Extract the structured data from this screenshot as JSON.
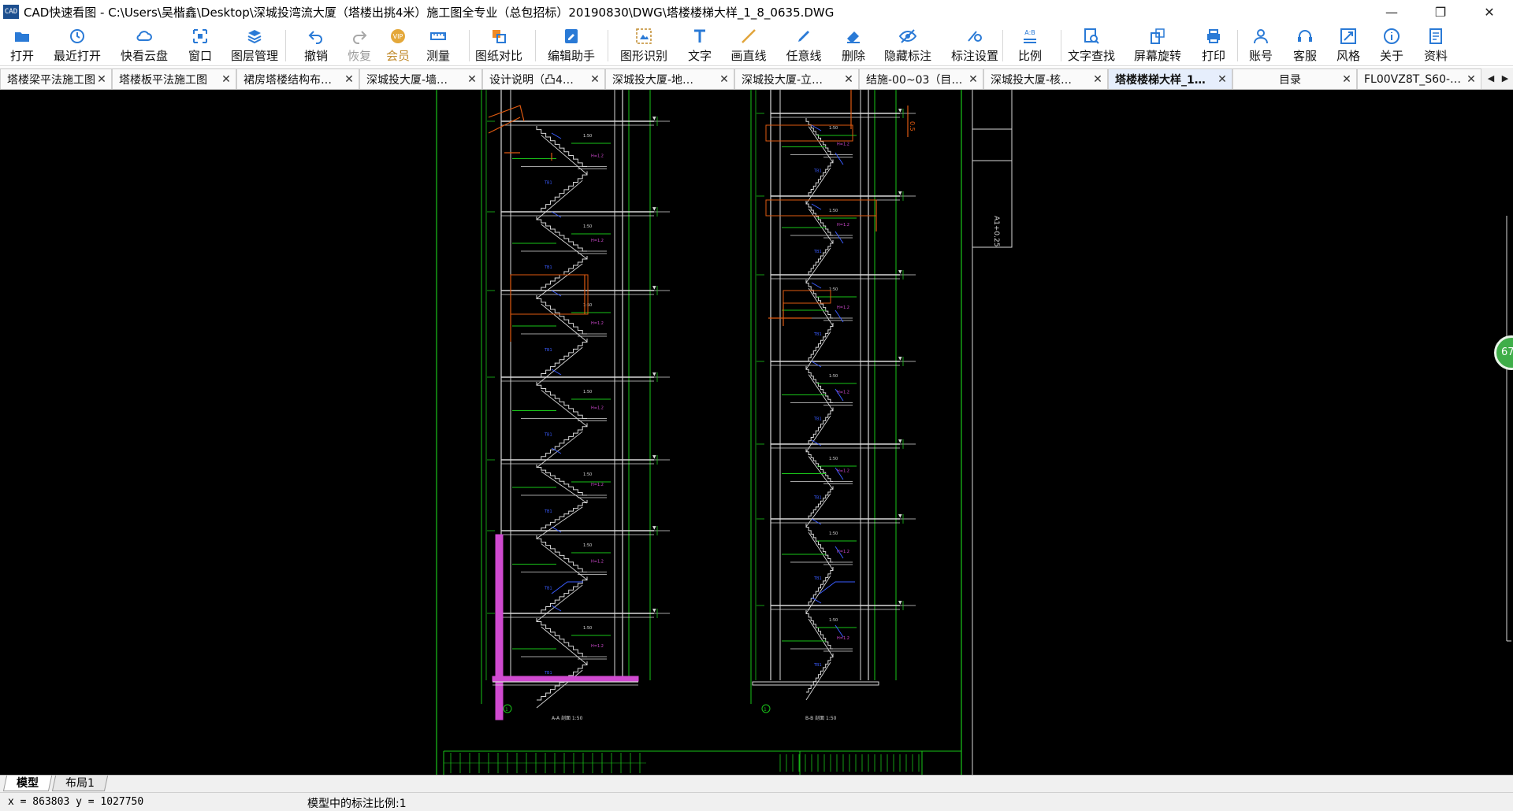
{
  "window": {
    "title": "CAD快速看图 - C:\\Users\\吴楷鑫\\Desktop\\深城投湾流大厦（塔楼出挑4米）施工图全专业（总包招标）20190830\\DWG\\塔楼楼梯大样_1_8_0635.DWG",
    "app_icon_text": "CAD",
    "minimize": "—",
    "maximize": "❐",
    "close": "✕"
  },
  "toolbar": [
    {
      "id": "open",
      "label": "打开",
      "icon": "folder-icon"
    },
    {
      "id": "recent",
      "label": "最近打开",
      "icon": "clock-icon"
    },
    {
      "id": "cloud",
      "label": "快看云盘",
      "icon": "cloud-icon"
    },
    {
      "id": "window",
      "label": "窗口",
      "icon": "window-icon"
    },
    {
      "id": "layers",
      "label": "图层管理",
      "icon": "layers-icon"
    },
    {
      "id": "undo",
      "label": "撤销",
      "icon": "undo-icon"
    },
    {
      "id": "redo",
      "label": "恢复",
      "icon": "redo-icon",
      "disabled": true
    },
    {
      "id": "vip",
      "label": "会员",
      "icon": "vip-icon",
      "badge": "VIP"
    },
    {
      "id": "measure",
      "label": "测量",
      "icon": "ruler-icon"
    },
    {
      "id": "compare",
      "label": "图纸对比",
      "icon": "compare-icon"
    },
    {
      "id": "edit",
      "label": "编辑助手",
      "icon": "edit-assistant-icon"
    },
    {
      "id": "recognize",
      "label": "图形识别",
      "icon": "shape-recognize-icon"
    },
    {
      "id": "text",
      "label": "文字",
      "icon": "text-icon"
    },
    {
      "id": "line",
      "label": "画直线",
      "icon": "line-icon"
    },
    {
      "id": "freeline",
      "label": "任意线",
      "icon": "pen-icon"
    },
    {
      "id": "delete",
      "label": "删除",
      "icon": "eraser-icon"
    },
    {
      "id": "hide",
      "label": "隐藏标注",
      "icon": "eye-icon"
    },
    {
      "id": "dimset",
      "label": "标注设置",
      "icon": "dim-settings-icon"
    },
    {
      "id": "ratio",
      "label": "比例",
      "icon": "ratio-icon",
      "badge": "A:B"
    },
    {
      "id": "find",
      "label": "文字查找",
      "icon": "text-search-icon"
    },
    {
      "id": "rotate",
      "label": "屏幕旋转",
      "icon": "rotate-icon"
    },
    {
      "id": "print",
      "label": "打印",
      "icon": "printer-icon"
    },
    {
      "id": "account",
      "label": "账号",
      "icon": "user-icon"
    },
    {
      "id": "service",
      "label": "客服",
      "icon": "headset-icon"
    },
    {
      "id": "style",
      "label": "风格",
      "icon": "style-icon"
    },
    {
      "id": "about",
      "label": "关于",
      "icon": "info-icon"
    },
    {
      "id": "docs",
      "label": "资料",
      "icon": "book-icon"
    }
  ],
  "tabs": [
    {
      "label": "塔楼梁平法施工图",
      "active": false
    },
    {
      "label": "塔楼板平法施工图",
      "active": false
    },
    {
      "label": "裙房塔楼结构布…",
      "active": false
    },
    {
      "label": "深城投大厦-墙…",
      "active": false
    },
    {
      "label": "设计说明（凸4…",
      "active": false
    },
    {
      "label": "深城投大厦-地…",
      "active": false
    },
    {
      "label": "深城投大厦-立…",
      "active": false
    },
    {
      "label": "结施-00~03（目…",
      "active": false
    },
    {
      "label": "深城投大厦-核…",
      "active": false
    },
    {
      "label": "塔楼楼梯大样_1…",
      "active": true
    },
    {
      "label": "目录",
      "active": false
    },
    {
      "label": "FL00VZ8T_S60-…",
      "active": false
    }
  ],
  "tab_close": "✕",
  "tab_nav": {
    "prev": "◀",
    "next": "▶"
  },
  "canvas": {
    "background": "#000000",
    "line_white": "#d8d8d8",
    "line_green": "#19c419",
    "line_orange": "#e05a10",
    "line_magenta": "#d04ad0",
    "line_blue": "#3a5cff",
    "side_badge": "67",
    "legend_text": "A1+0.25",
    "section_label_left": "A-A 剖面 1:50",
    "section_label_right": "B-B 剖面 1:50",
    "axis_label_left": "1",
    "axis_label_right": "1"
  },
  "layout_tabs": [
    {
      "label": "模型",
      "active": true
    },
    {
      "label": "布局1",
      "active": false
    }
  ],
  "status": {
    "coords": "x = 863803  y = 1027750",
    "scale_text": "模型中的标注比例:1"
  }
}
